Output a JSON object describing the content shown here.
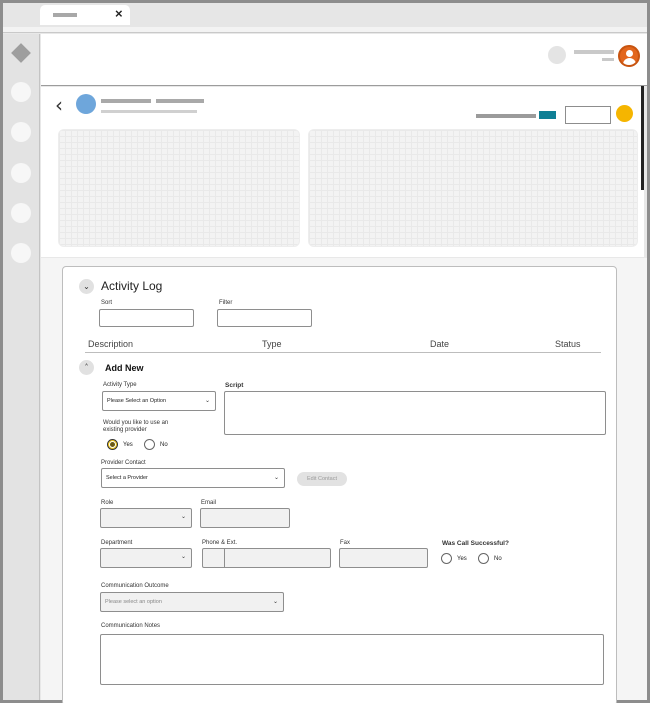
{
  "window": {
    "tab_close_icon": "×"
  },
  "header": {
    "avatar_icon": "user-icon"
  },
  "nav": {
    "back_icon": "‹"
  },
  "activity_log": {
    "title": "Activity Log",
    "sort_label": "Sort",
    "filter_label": "Filter",
    "columns": [
      "Description",
      "Type",
      "Date",
      "Status"
    ],
    "collapse_glyph": "⌄"
  },
  "add_new": {
    "title": "Add New",
    "expand_glyph": "˄",
    "activity_type_label": "Activity Type",
    "activity_type_value": "Please Select an Option",
    "script_label": "Script",
    "existing_provider_question": "Would you like to use an existing provider",
    "yes": "Yes",
    "no": "No",
    "existing_provider_selected": "Yes",
    "provider_contact_label": "Provider Contact",
    "provider_value": "Select a Provider",
    "edit_contact_label": "Edit Contact",
    "role_label": "Role",
    "email_label": "Email",
    "department_label": "Department",
    "phone_label": "Phone & Ext.",
    "fax_label": "Fax",
    "call_success_label": "Was Call Successful?",
    "outcome_label": "Communication Outcome",
    "outcome_placeholder": "Please select an option",
    "notes_label": "Communication Notes"
  },
  "colors": {
    "avatar": "#e2661d",
    "blue_dot": "#6ea6db",
    "teal_badge": "#0f7f95",
    "yellow_dot": "#f5b500"
  }
}
